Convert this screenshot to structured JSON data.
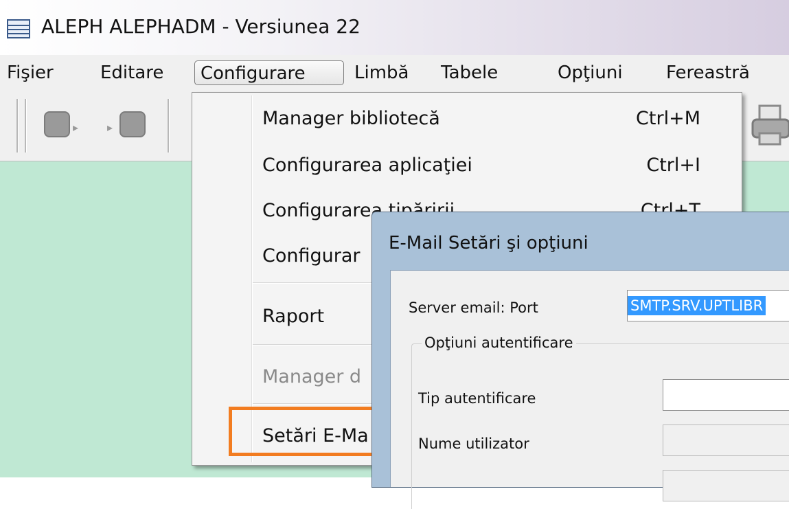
{
  "window": {
    "title": "ALEPH ALEPHADM - Versiunea 22",
    "icon": "table-grid-icon"
  },
  "menubar": {
    "items": [
      "Fişier",
      "Editare",
      "Configurare",
      "Limbă",
      "Tabele",
      "Opţiuni",
      "Fereastră"
    ],
    "active": "Configurare"
  },
  "dropdown": {
    "items": [
      {
        "label": "Manager bibliotecă",
        "shortcut": "Ctrl+M"
      },
      {
        "label": "Configurarea aplicaţiei",
        "shortcut": "Ctrl+I"
      },
      {
        "label": "Configurarea tipăririi",
        "shortcut": "Ctrl+T"
      },
      {
        "label": "Configurar",
        "shortcut": ""
      },
      {
        "label": "Raport",
        "shortcut": ""
      },
      {
        "label": "Manager d",
        "shortcut": "",
        "disabled": true
      },
      {
        "label": "Setări E-Ma",
        "shortcut": "",
        "highlighted": true
      }
    ]
  },
  "dialog": {
    "title": "E-Mail Setări şi opţiuni",
    "server_label": "Server email: Port",
    "server_value": "SMTP.SRV.UPTLIBR",
    "auth_group": "Opţiuni autentificare",
    "auth_type_label": "Tip autentificare",
    "auth_type_value": "",
    "username_label": "Nume utilizator",
    "username_value": ""
  },
  "colors": {
    "workspace": "#bfe8d3",
    "highlight": "#f27c20",
    "selection": "#3399ff"
  }
}
